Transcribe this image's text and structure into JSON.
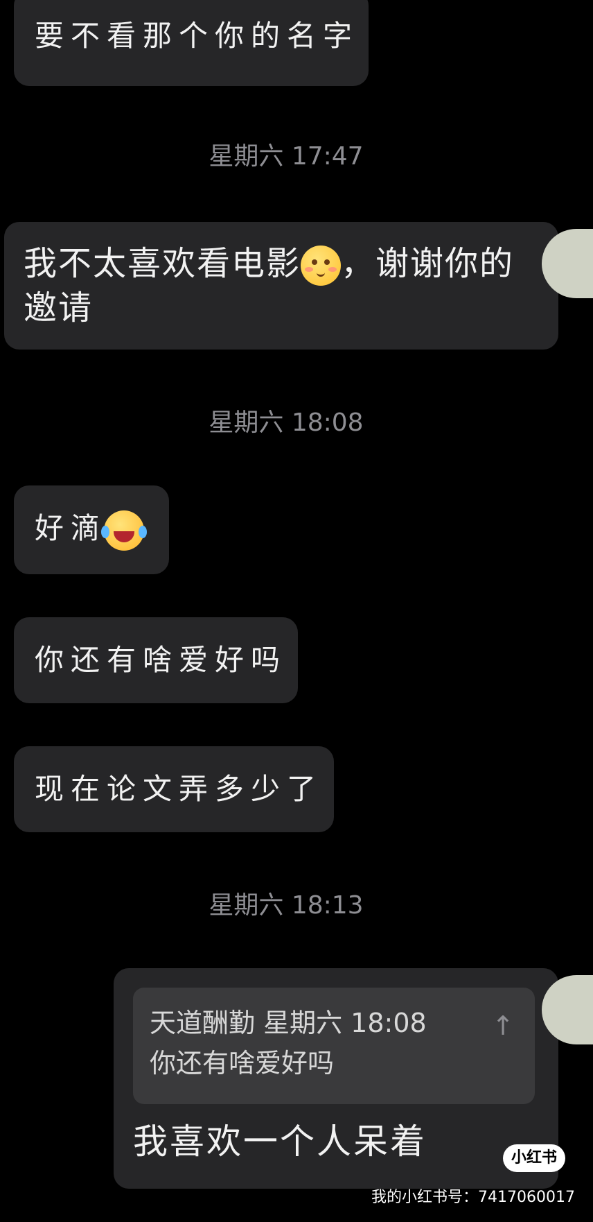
{
  "messages": {
    "m1": "要不看那个你的名字",
    "ts1": "星期六 17:47",
    "m2_part1": "我不太喜欢看电影",
    "m2_part2": "，谢谢你的邀请",
    "ts2": "星期六 18:08",
    "m3": "好滴",
    "m4": "你还有啥爱好吗",
    "m5": "现在论文弄多少了",
    "ts3": "星期六 18:13",
    "reply": {
      "quote_header": "天道酬勤 星期六 18:08",
      "quote_text": "你还有啥爱好吗",
      "pin_icon": "↑",
      "text": "我喜欢一个人呆着"
    }
  },
  "emoji": {
    "shy": "shy-face-icon",
    "laugh": "tears-of-joy-icon"
  },
  "watermark": {
    "badge": "小红书",
    "text": "我的小红书号：7417060017"
  },
  "colors": {
    "background": "#000000",
    "bubble": "#262628",
    "quote": "#3a3a3c",
    "timestamp": "#8e8e93"
  }
}
